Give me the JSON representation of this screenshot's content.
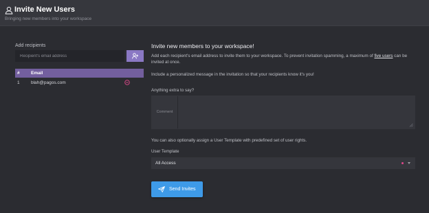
{
  "header": {
    "title": "Invite New Users",
    "subtitle": "Bringing new members into your workspace",
    "icon": "user-icon"
  },
  "recipients": {
    "label": "Add recipients",
    "input_placeholder": "Recipient's email address",
    "add_icon": "add-user-icon",
    "table": {
      "columns": [
        "#",
        "Email"
      ],
      "rows": [
        {
          "index": "1",
          "email": "blah@pagos.com"
        }
      ]
    }
  },
  "invite": {
    "heading": "Invite new members to your workspace!",
    "description_part1": "Add each recipient's email address to invite them to your workspace. To prevent invitation spamming, a maximum of ",
    "description_link": "five users",
    "description_part2": " can be invited at once.",
    "personal_message_note": "Include a personalized message in the invitation so that your recipients know it's you!",
    "extra_label": "Anything extra to say?",
    "comment_addon": "Comment",
    "template_note": "You can also optionally assign a User Template with predefined set of user rights.",
    "template_label": "User Template",
    "template_value": "All Access",
    "send_label": "Send Invites"
  },
  "colors": {
    "background": "#2b2c31",
    "header": "#36373d",
    "accent_purple": "#8a78c4",
    "table_header": "#735f9e",
    "primary_button": "#3e9ae8",
    "danger": "#e0488b"
  }
}
